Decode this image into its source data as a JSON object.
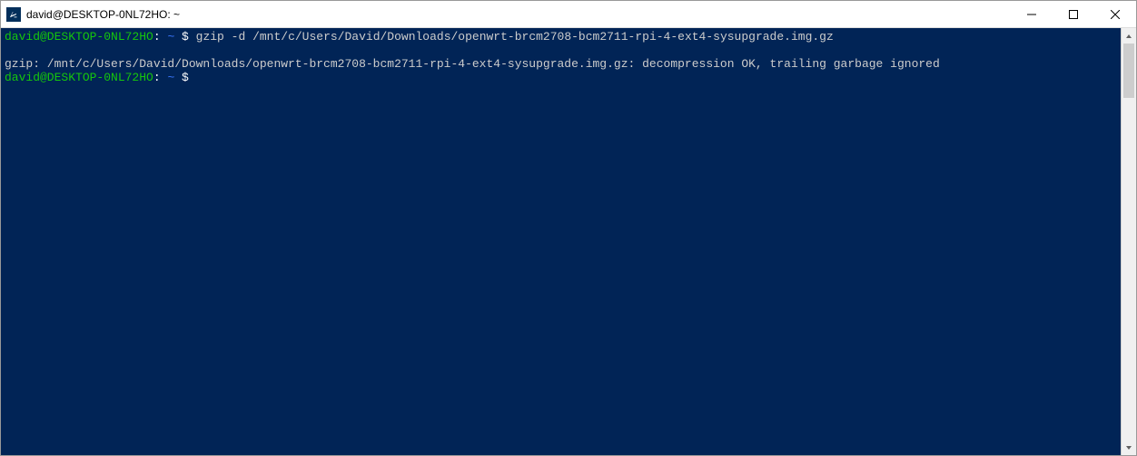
{
  "window": {
    "title": "david@DESKTOP-0NL72HO: ~"
  },
  "terminal": {
    "lines": [
      {
        "type": "prompt",
        "user": "david@DESKTOP-0NL72HO",
        "sep": ":",
        "path": "~",
        "dollar": "$",
        "command": "gzip -d /mnt/c/Users/David/Downloads/openwrt-brcm2708-bcm2711-rpi-4-ext4-sysupgrade.img.gz"
      },
      {
        "type": "blank"
      },
      {
        "type": "output",
        "text": "gzip: /mnt/c/Users/David/Downloads/openwrt-brcm2708-bcm2711-rpi-4-ext4-sysupgrade.img.gz: decompression OK, trailing garbage ignored"
      },
      {
        "type": "prompt",
        "user": "david@DESKTOP-0NL72HO",
        "sep": ":",
        "path": "~",
        "dollar": "$",
        "command": ""
      }
    ]
  }
}
